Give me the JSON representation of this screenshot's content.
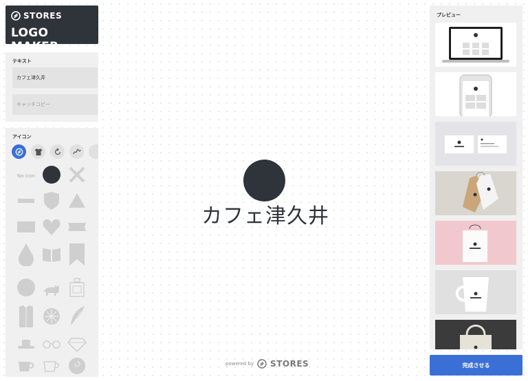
{
  "brand": {
    "name": "STORES",
    "product": "LOGO MAKER"
  },
  "text_panel": {
    "title": "テキスト",
    "name_value": "カフェ津久井",
    "catch_placeholder": "キャッチコピー"
  },
  "icon_panel": {
    "title": "アイコン",
    "no_icon_label": "No icon",
    "categories": [
      "stores-icon",
      "shirt-icon",
      "rotate-icon",
      "scribble-icon"
    ]
  },
  "canvas": {
    "logo_name": "カフェ津久井",
    "powered_by": "powered by",
    "powered_brand": "STORES"
  },
  "preview_panel": {
    "title": "プレビュー",
    "mockups": [
      "laptop",
      "smartphone",
      "business-cards",
      "hang-tags",
      "paper-bag",
      "mug",
      "tote-bag"
    ],
    "mockup_label": "カフェ津久井"
  },
  "actions": {
    "complete": "完成させる"
  },
  "colors": {
    "accent": "#3a6fd6",
    "logo": "#2f343b",
    "panel": "#f0f0f0",
    "icon_gray": "#cfcfcf"
  }
}
